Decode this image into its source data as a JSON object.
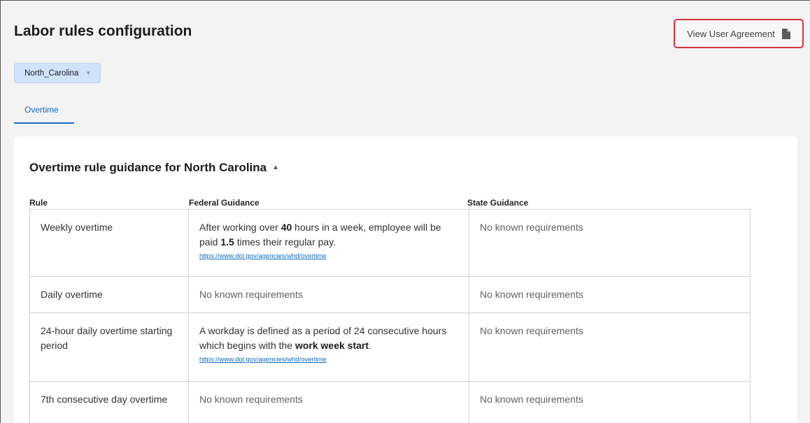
{
  "header": {
    "title": "Labor rules configuration",
    "user_agreement_label": "View User Agreement"
  },
  "state_selector": {
    "selected": "North_Carolina"
  },
  "tabs": [
    {
      "label": "Overtime",
      "active": true
    }
  ],
  "section": {
    "title": "Overtime rule guidance for North Carolina",
    "columns": {
      "rule": "Rule",
      "federal": "Federal Guidance",
      "state": "State Guidance"
    }
  },
  "rows": [
    {
      "rule": "Weekly overtime",
      "federal": {
        "p1": "After working over ",
        "b1": "40",
        "p2": " hours in a week, employee will be paid ",
        "b2": "1.5",
        "p3": " times their regular pay.",
        "link": "https://www.dol.gov/agencies/whd/overtime"
      },
      "state": "No known requirements"
    },
    {
      "rule": "Daily overtime",
      "federal_text": "No known requirements",
      "state": "No known requirements"
    },
    {
      "rule": "24-hour daily overtime starting period",
      "federal": {
        "p1": "A workday is defined as a period of 24 consecutive hours which begins with the ",
        "b1": "work week start",
        "p2": ".",
        "link": "https://www.dol.gov/agencies/whd/overtime"
      },
      "state": "No known requirements"
    },
    {
      "rule": "7th consecutive day overtime",
      "federal_text": "No known requirements",
      "state": "No known requirements"
    }
  ],
  "colors": {
    "accent": "#0f6cbd",
    "highlight_border": "#d9323a",
    "chip_background": "#cfe4fa"
  },
  "icons": {
    "user_agreement": "document-icon",
    "state_dropdown": "chevron-down-icon",
    "section_toggle": "chevron-up-icon"
  }
}
